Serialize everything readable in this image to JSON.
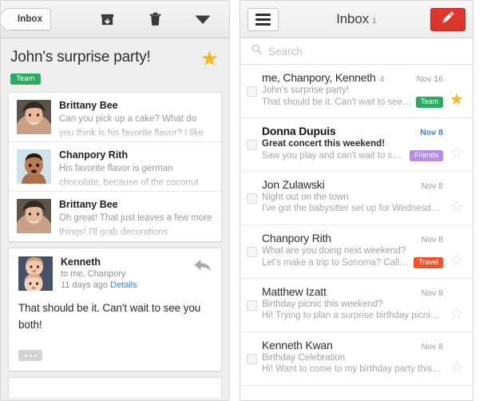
{
  "conversation": {
    "toolbar": {
      "back_label": "Inbox",
      "icons": [
        "archive-icon",
        "trash-icon",
        "chevron-down-icon"
      ]
    },
    "subject": "John's surprise party!",
    "starred": true,
    "label": {
      "text": "Team",
      "color": "#2cab5e"
    },
    "messages": [
      {
        "sender": "Brittany Bee",
        "snippet": "Can you pick up a cake? What do you think is his favorite flavor? I like",
        "avatar": "photo-woman"
      },
      {
        "sender": "Chanpory Rith",
        "snippet": "His favorite flavor is german chocolate, because of the coconut",
        "avatar": "illustration-man"
      },
      {
        "sender": "Brittany Bee",
        "snippet": "Oh great! That just leaves a few more things! I'll grab decorations",
        "avatar": "photo-woman"
      }
    ],
    "open_message": {
      "sender": "Kenneth",
      "recipients": "to me, Chanpory",
      "time": "11 days ago",
      "details_label": "Details",
      "body": "That should be it. Can't wait to see you both!",
      "avatar": "photo-babies",
      "reply_icon": "reply-arrow-icon",
      "more_icon": "ellipsis-icon"
    }
  },
  "inbox": {
    "menu_icon": "hamburger-icon",
    "title": "Inbox",
    "count": "1",
    "compose_icon": "pencil-icon",
    "compose_color": "#da372c",
    "search": {
      "placeholder": "Search",
      "icon": "search-icon"
    },
    "emails": [
      {
        "sender": "me, Chanpory, Kenneth",
        "msg_count": "4",
        "date": "Nov 16",
        "subject": "John's surprise party!",
        "snippet": "That should be it. Can't wait to see…",
        "chip": "Team",
        "chip_color": "#2cab5e",
        "starred": true,
        "unread": false
      },
      {
        "sender": "Donna Dupuis",
        "msg_count": "",
        "date": "Nov 8",
        "subject": "Great concert this weekend!",
        "snippet": "Saw you play and can't wait to se…",
        "chip": "Friends",
        "chip_color": "#b78bea",
        "starred": false,
        "unread": true
      },
      {
        "sender": "Jon Zulawski",
        "msg_count": "",
        "date": "Nov 8",
        "subject": "Night out on the town",
        "snippet": "I've got the babysitter set up for Wednesd…",
        "chip": "",
        "chip_color": "",
        "starred": false,
        "unread": false
      },
      {
        "sender": "Chanpory Rith",
        "msg_count": "",
        "date": "Nov 8",
        "subject": "What are you doing next weekend?",
        "snippet": "Let's make a trip to Sonoma? Call …",
        "chip": "Travel",
        "chip_color": "#f4502a",
        "starred": false,
        "unread": false
      },
      {
        "sender": "Matthew Izatt",
        "msg_count": "",
        "date": "Nov 8",
        "subject": "Birthday picnic this weekend?",
        "snippet": "Hi! Trying to plan a surprise birthday picnic…",
        "chip": "",
        "chip_color": "",
        "starred": false,
        "unread": false
      },
      {
        "sender": "Kenneth Kwan",
        "msg_count": "",
        "date": "Nov 8",
        "subject": "Birthday Celebration",
        "snippet": "Hi! Want to come to my birthday party this…",
        "chip": "",
        "chip_color": "",
        "starred": false,
        "unread": false
      }
    ]
  }
}
